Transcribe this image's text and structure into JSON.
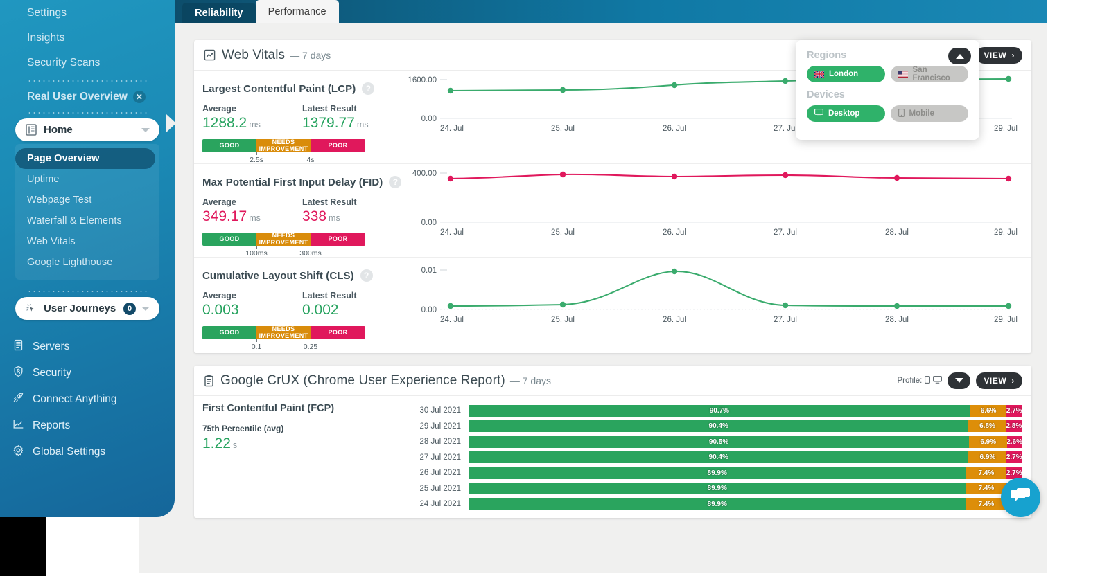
{
  "tabs": [
    {
      "label": "Reliability",
      "active": false
    },
    {
      "label": "Performance",
      "active": true
    }
  ],
  "sidebar": {
    "top_links": [
      "Settings",
      "Insights",
      "Security Scans"
    ],
    "project": {
      "label": "Real User Overview",
      "close_icon": "close-icon"
    },
    "home": {
      "label": "Home",
      "icon": "page-icon"
    },
    "submenu": [
      {
        "label": "Page Overview",
        "active": true
      },
      {
        "label": "Uptime",
        "active": false
      },
      {
        "label": "Webpage Test",
        "active": false
      },
      {
        "label": "Waterfall & Elements",
        "active": false
      },
      {
        "label": "Web Vitals",
        "active": false
      },
      {
        "label": "Google Lighthouse",
        "active": false
      }
    ],
    "user_journeys": {
      "label": "User Journeys",
      "badge": "0",
      "icon": "cursor-click-icon"
    },
    "bottom_items": [
      {
        "label": "Servers",
        "icon": "server-icon"
      },
      {
        "label": "Security",
        "icon": "shield-icon"
      },
      {
        "label": "Connect Anything",
        "icon": "rocket-icon"
      },
      {
        "label": "Reports",
        "icon": "chart-line-icon"
      },
      {
        "label": "Global Settings",
        "icon": "gear-icon"
      }
    ]
  },
  "web_vitals_card": {
    "icon": "chart-square-icon",
    "title": "Web Vitals",
    "subtitle": "— 7 days",
    "view_label": "VIEW",
    "collapse_icon": "chevron-up-icon"
  },
  "region_popup": {
    "regions_label": "Regions",
    "devices_label": "Devices",
    "collapse_icon": "chevron-up-icon",
    "regions": [
      {
        "label": "London",
        "icon": "flag-uk-icon",
        "selected": true
      },
      {
        "label": "San Francisco",
        "icon": "flag-us-icon",
        "selected": false
      }
    ],
    "devices": [
      {
        "label": "Desktop",
        "icon": "desktop-icon",
        "selected": true
      },
      {
        "label": "Mobile",
        "icon": "mobile-icon",
        "selected": false
      }
    ]
  },
  "metrics": [
    {
      "name": "Largest Contentful Paint (LCP)",
      "average_label": "Average",
      "average_value": "1288.2",
      "average_unit": "ms",
      "average_color": "green",
      "latest_label": "Latest Result",
      "latest_value": "1379.77",
      "latest_unit": "ms",
      "latest_color": "green",
      "scale": {
        "good": "GOOD",
        "needs": "NEEDS IMPROVEMENT",
        "poor": "POOR",
        "tick1": "2.5s",
        "tick2": "4s"
      }
    },
    {
      "name": "Max Potential First Input Delay (FID)",
      "average_label": "Average",
      "average_value": "349.17",
      "average_unit": "ms",
      "average_color": "red",
      "latest_label": "Latest Result",
      "latest_value": "338",
      "latest_unit": "ms",
      "latest_color": "red",
      "scale": {
        "good": "GOOD",
        "needs": "NEEDS IMPROVEMENT",
        "poor": "POOR",
        "tick1": "100ms",
        "tick2": "300ms"
      }
    },
    {
      "name": "Cumulative Layout Shift (CLS)",
      "average_label": "Average",
      "average_value": "0.003",
      "average_unit": "",
      "average_color": "green",
      "latest_label": "Latest Result",
      "latest_value": "0.002",
      "latest_unit": "",
      "latest_color": "green",
      "scale": {
        "good": "GOOD",
        "needs": "NEEDS IMPROVEMENT",
        "poor": "POOR",
        "tick1": "0.1",
        "tick2": "0.25"
      }
    }
  ],
  "crux_card": {
    "icon": "clipboard-icon",
    "title": "Google CrUX (Chrome User Experience Report)",
    "subtitle": "— 7 days",
    "profile_label": "Profile:",
    "profile_icons": [
      "mobile-icon",
      "desktop-icon"
    ],
    "view_label": "VIEW",
    "dropdown_icon": "chevron-down-icon",
    "metric_name": "First Contentful Paint (FCP)",
    "percentile_label": "75th Percentile (avg)",
    "percentile_value": "1.22",
    "percentile_unit": "s"
  },
  "chat": {
    "icon": "chat-bubble-icon"
  },
  "chart_data": [
    {
      "type": "line",
      "title": "Largest Contentful Paint (LCP)",
      "color": "#2aa45e",
      "xlabel": "",
      "ylabel": "",
      "categories": [
        "24. Jul",
        "25. Jul",
        "26. Jul",
        "27. Jul",
        "28. Jul",
        "29. Jul"
      ],
      "values": [
        1288,
        1290,
        1400,
        1480,
        1470,
        1460
      ],
      "ylim": [
        0,
        1600
      ],
      "yticks": [
        "0.00",
        "1600.00"
      ],
      "grid": false,
      "legend": "none"
    },
    {
      "type": "line",
      "title": "Max Potential First Input Delay (FID)",
      "color": "#e0185c",
      "xlabel": "",
      "ylabel": "",
      "categories": [
        "24. Jul",
        "25. Jul",
        "26. Jul",
        "27. Jul",
        "28. Jul",
        "29. Jul"
      ],
      "values": [
        349,
        374,
        362,
        370,
        350,
        338
      ],
      "ylim": [
        0,
        400
      ],
      "yticks": [
        "0.00",
        "400.00"
      ],
      "grid": false,
      "legend": "none"
    },
    {
      "type": "line",
      "title": "Cumulative Layout Shift (CLS)",
      "color": "#2aa45e",
      "xlabel": "",
      "ylabel": "",
      "categories": [
        "24. Jul",
        "25. Jul",
        "26. Jul",
        "27. Jul",
        "28. Jul",
        "29. Jul"
      ],
      "values": [
        0.0012,
        0.0016,
        0.0095,
        0.0011,
        0.0012,
        0.0012
      ],
      "ylim": [
        0,
        0.01
      ],
      "yticks": [
        "0.00",
        "0.01"
      ],
      "grid": false,
      "legend": "none"
    },
    {
      "type": "bar",
      "title": "First Contentful Paint (FCP)",
      "orientation": "horizontal",
      "stacked": true,
      "categories": [
        "30 Jul 2021",
        "29 Jul 2021",
        "28 Jul 2021",
        "27 Jul 2021",
        "26 Jul 2021",
        "25 Jul 2021",
        "24 Jul 2021"
      ],
      "series": [
        {
          "name": "Good",
          "color": "#2aa45e",
          "values": [
            90.7,
            90.4,
            90.5,
            90.4,
            89.9,
            89.9,
            89.9
          ]
        },
        {
          "name": "Needs Improvement",
          "color": "#dd8e09",
          "values": [
            6.6,
            6.8,
            6.9,
            6.9,
            7.4,
            7.4,
            7.4
          ]
        },
        {
          "name": "Poor",
          "color": "#e0185c",
          "values": [
            2.7,
            2.8,
            2.6,
            2.7,
            2.7,
            2.7,
            2.7
          ]
        }
      ],
      "labels": [
        {
          "good": "90.7%",
          "needs": "6.6%",
          "poor": "2.7%"
        },
        {
          "good": "90.4%",
          "needs": "6.8%",
          "poor": "2.8%"
        },
        {
          "good": "90.5%",
          "needs": "6.9%",
          "poor": "2.6%"
        },
        {
          "good": "90.4%",
          "needs": "6.9%",
          "poor": "2.7%"
        },
        {
          "good": "89.9%",
          "needs": "7.4%",
          "poor": "2.7%"
        },
        {
          "good": "89.9%",
          "needs": "7.4%",
          "poor": "2.7%"
        },
        {
          "good": "89.9%",
          "needs": "7.4%",
          "poor": "2.7%"
        }
      ],
      "xlim": [
        0,
        100
      ],
      "grid": false,
      "legend": "none"
    }
  ]
}
